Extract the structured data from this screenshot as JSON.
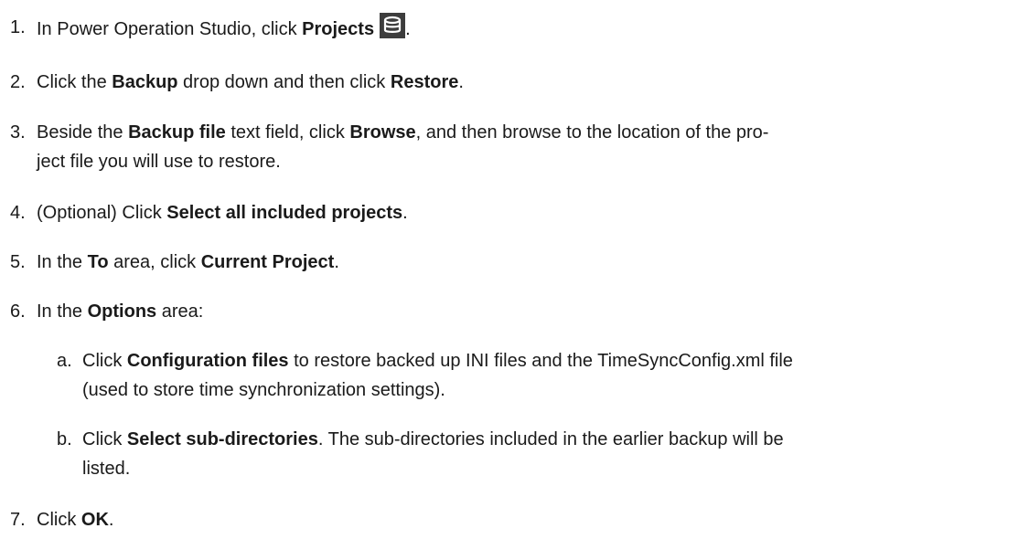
{
  "steps": [
    {
      "number": "1.",
      "prefix": "In Power Operation Studio, click ",
      "bold1": "Projects",
      "icon": "database-icon",
      "suffix": "."
    },
    {
      "number": "2.",
      "prefix": "Click the ",
      "bold1": "Backup",
      "middle": " drop down and then click ",
      "bold2": "Restore",
      "suffix": "."
    },
    {
      "number": "3.",
      "prefix": "Beside the ",
      "bold1": "Backup file",
      "middle": " text field, click ",
      "bold2": "Browse",
      "suffix_line1": ", and then browse to the location of the pro-",
      "suffix_line2": "ject file you will use to restore."
    },
    {
      "number": "4.",
      "prefix": "(Optional) Click ",
      "bold1": "Select all included projects",
      "suffix": "."
    },
    {
      "number": "5.",
      "prefix": "In the ",
      "bold1": "To",
      "middle": " area, click ",
      "bold2": "Current Project",
      "suffix": "."
    },
    {
      "number": "6.",
      "prefix": "In the ",
      "bold1": "Options",
      "suffix": " area:",
      "substeps": [
        {
          "letter": "a.",
          "prefix": "Click ",
          "bold1": "Configuration files",
          "suffix_line1": " to restore backed up INI files and the TimeSyncConfig.xml file",
          "suffix_line2": "(used to store time synchronization settings)."
        },
        {
          "letter": "b.",
          "prefix": "Click ",
          "bold1": "Select sub-directories",
          "suffix_line1": ". The sub-directories included in the earlier backup will be",
          "suffix_line2": "listed."
        }
      ]
    },
    {
      "number": "7.",
      "prefix": "Click ",
      "bold1": "OK",
      "suffix": "."
    }
  ]
}
